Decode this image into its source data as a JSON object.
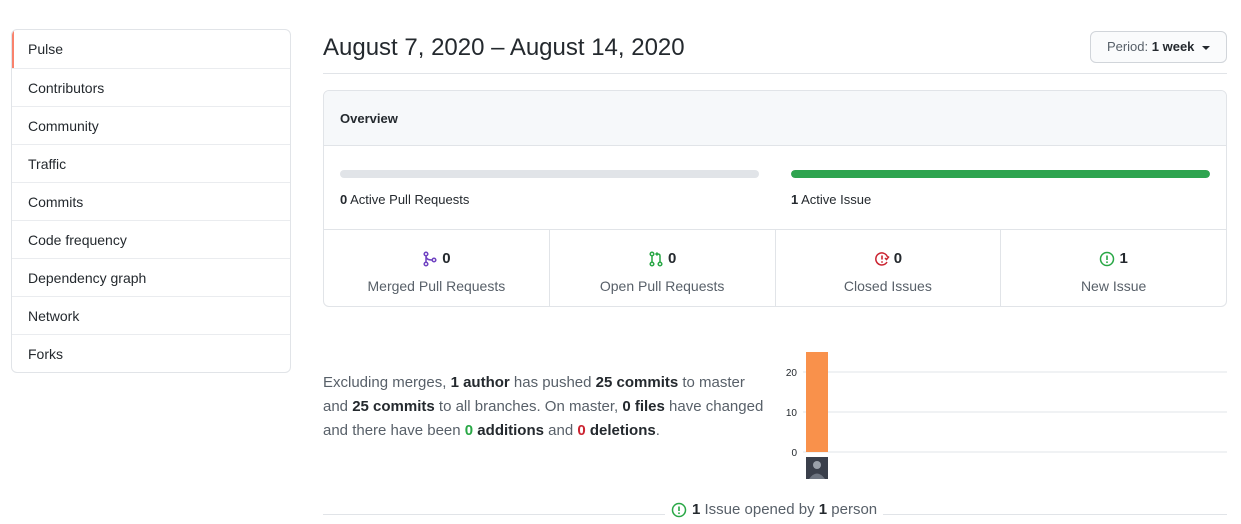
{
  "sidebar": {
    "items": [
      {
        "label": "Pulse",
        "selected": true
      },
      {
        "label": "Contributors"
      },
      {
        "label": "Community"
      },
      {
        "label": "Traffic"
      },
      {
        "label": "Commits"
      },
      {
        "label": "Code frequency"
      },
      {
        "label": "Dependency graph"
      },
      {
        "label": "Network"
      },
      {
        "label": "Forks"
      }
    ]
  },
  "header": {
    "title": "August 7, 2020 – August 14, 2020",
    "period_prefix": "Period:",
    "period_value": "1 week"
  },
  "overview": {
    "title": "Overview",
    "active_pull_requests": {
      "count": "0",
      "label": "Active Pull Requests",
      "fill_fraction": 0
    },
    "active_issues": {
      "count": "1",
      "label": "Active Issue",
      "fill_fraction": 1
    },
    "stats": [
      {
        "count": "0",
        "label": "Merged Pull Requests",
        "icon": "git-merge-icon",
        "color": "#6f42c1"
      },
      {
        "count": "0",
        "label": "Open Pull Requests",
        "icon": "git-pull-request-icon",
        "color": "#28a745"
      },
      {
        "count": "0",
        "label": "Closed Issues",
        "icon": "issue-closed-icon",
        "color": "#cb2431"
      },
      {
        "count": "1",
        "label": "New Issue",
        "icon": "issue-opened-icon",
        "color": "#28a745"
      }
    ]
  },
  "summary": {
    "p1": "Excluding merges, ",
    "authors": "1 author",
    "p2": " has pushed ",
    "commits_master": "25 commits",
    "p3": " to master and ",
    "commits_all": "25 commits",
    "p4": " to all branches. On master, ",
    "files": "0 files",
    "p5": " have changed and there have been ",
    "additions_num": "0",
    "additions_word": " additions",
    "p6": " and ",
    "deletions_num": "0",
    "deletions_word": " deletions",
    "p7": "."
  },
  "chart_data": {
    "type": "bar",
    "categories": [
      ""
    ],
    "values": [
      25
    ],
    "ylim": [
      0,
      25
    ],
    "yticks": [
      "0",
      "10",
      "20"
    ],
    "grid": true,
    "color": "#f9914b"
  },
  "issues_footer": {
    "count": "1",
    "text": " Issue opened by ",
    "people": "1",
    "suffix": " person"
  },
  "colors": {
    "accent": "#f9826c",
    "green": "#2ea44f",
    "bar": "#f9914b"
  }
}
